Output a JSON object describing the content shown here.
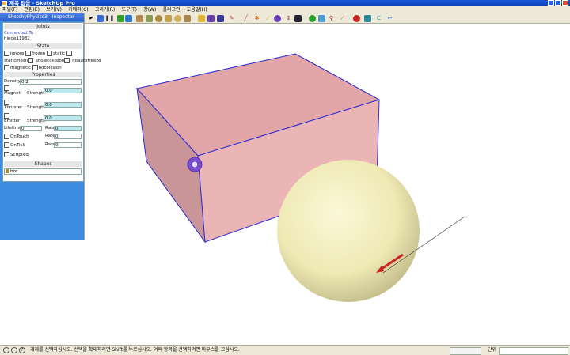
{
  "window": {
    "title": "제목 없음 - SketchUp Pro"
  },
  "menu": [
    "파일(F)",
    "편집(E)",
    "보기(V)",
    "카메라(C)",
    "그리기(R)",
    "도구(T)",
    "창(W)",
    "플러그인",
    "도움말(H)"
  ],
  "toolbar": {
    "icons": [
      "arrow-cursor-icon",
      "eraser-icon",
      "stamp-icon",
      "play-icon",
      "pause-icon",
      "stop-icon",
      "layers-icon",
      "folder-icon",
      "box-icon",
      "box-icon",
      "cylinder-icon",
      "cone-icon",
      "sphere-icon",
      "torus-icon",
      "key-icon",
      "magnet-icon",
      "link-icon",
      "wrench-icon",
      "pen-icon",
      "gear-icon",
      "spring-icon",
      "joint-icon",
      "slider-icon",
      "dot-icon",
      "ball-icon",
      "leaf-icon",
      "pin-icon",
      "stick-icon",
      "record-icon",
      "emitter-icon",
      "thruster-icon",
      "exit-icon"
    ],
    "colors": {
      "play": "#2ea02e",
      "stop": "#d02020",
      "record": "#cc2222"
    }
  },
  "panel": {
    "title": "SketchyPhysics3 - Inspector",
    "joints": {
      "heading": "Joints",
      "connected_label": "Connected To",
      "connected_value": "hinge11982"
    },
    "state": {
      "heading": "State",
      "row1": [
        "ignore",
        "frozen",
        "static"
      ],
      "row2": [
        "staticmesh",
        "showcollision",
        "noautofreeze"
      ],
      "row3": [
        "magnetic",
        "nocollision"
      ]
    },
    "properties": {
      "heading": "Properties",
      "density_label": "Density",
      "density_value": "0.2",
      "magnet_label": "Magnet",
      "magnet_strength_label": "Strength",
      "magnet_value": "0.0",
      "thruster_label": "Thruster",
      "thruster_strength_label": "Strength",
      "thruster_value": "0.0",
      "emitter_label": "Emitter",
      "emitter_strength_label": "Strength",
      "emitter_value": "0.0",
      "lifetime_label": "Lifetime",
      "lifetime_value": "0",
      "lifetime_rate_label": "Rate",
      "lifetime_rate_value": "0",
      "ontouch_label": "OnTouch",
      "ontouch_rate_label": "Rate",
      "ontouch_rate_value": "0",
      "ontick_label": "OnTick",
      "ontick_rate_label": "Rate",
      "ontick_rate_value": "0",
      "scripted_label": "Scripted"
    },
    "shapes": {
      "heading": "Shapes",
      "value": "box"
    }
  },
  "scene": {
    "box_color": "#e8b0b0",
    "box_edge_color": "#2b2bd0",
    "sphere_color": "#f3efbf",
    "arrow_color": "#cc2222"
  },
  "status": {
    "help_text": "개체를 선택하십시오. 선택을 확대하려면 Shift를 누르십시오. 여러 항목을 선택하려면 마우스를 끄십시오.",
    "unit_label": "단위"
  }
}
